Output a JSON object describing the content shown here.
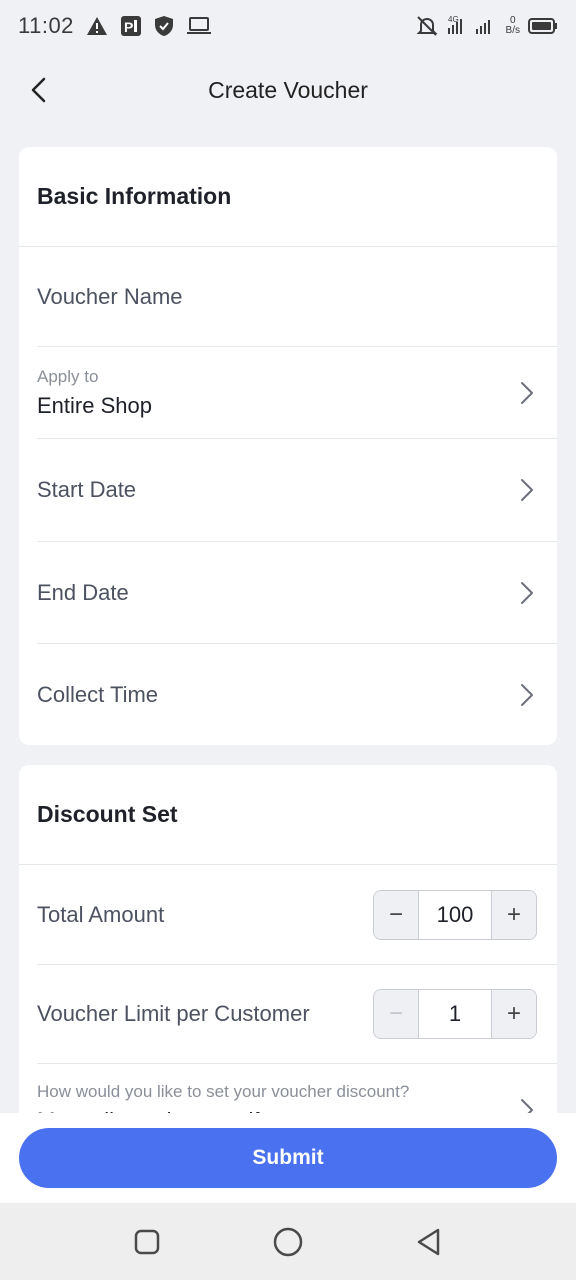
{
  "status_bar": {
    "time": "11:02",
    "network": "4G",
    "speed_value": "0",
    "speed_unit": "B/s",
    "icons_left": [
      "warning-icon",
      "parking-app-icon",
      "shield-icon",
      "laptop-icon"
    ],
    "icons_right": [
      "bell-off-icon",
      "signal-icon",
      "battery-icon"
    ]
  },
  "header": {
    "title": "Create Voucher",
    "back_icon": "chevron-left-icon"
  },
  "basic_info": {
    "title": "Basic Information",
    "voucher_name_placeholder": "Voucher Name",
    "apply_to_label": "Apply to",
    "apply_to_value": "Entire Shop",
    "start_date_label": "Start Date",
    "end_date_label": "End Date",
    "collect_time_label": "Collect Time"
  },
  "discount_set": {
    "title": "Discount Set",
    "total_amount_label": "Total Amount",
    "total_amount_value": "100",
    "limit_label": "Voucher Limit per Customer",
    "limit_value": "1",
    "discount_question": "How would you like to set your voucher discount?",
    "discount_value": "Manually set by myself"
  },
  "footer": {
    "submit_label": "Submit"
  },
  "colors": {
    "accent": "#4a72f0",
    "background": "#f0f1f5",
    "card": "#ffffff"
  }
}
